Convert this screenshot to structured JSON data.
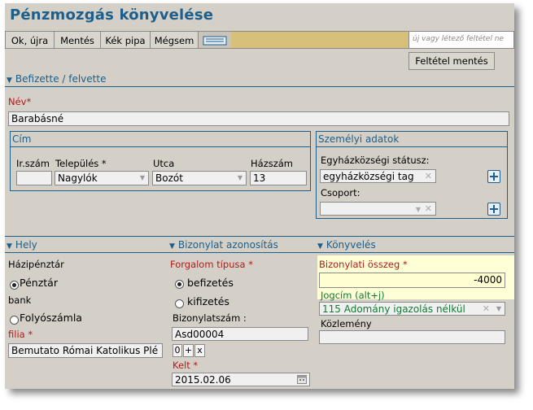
{
  "title": "Pénzmozgás könyvelése",
  "toolbar": {
    "ok_new": "Ok, újra",
    "save": "Mentés",
    "blue_tick": "Kék pipa",
    "cancel": "Mégsem",
    "filter_placeholder": "új vagy létező feltétel ne",
    "save_filter": "Feltétel mentés"
  },
  "payer_section": {
    "heading": "Befizette / felvette",
    "name_label": "Név*",
    "name_value": "Barabásné"
  },
  "address": {
    "title": "Cím",
    "zip_label": "Ir.szám",
    "zip_value": "",
    "city_label": "Település *",
    "city_value": "Nagylók",
    "street_label": "Utca",
    "street_value": "Bozót",
    "house_label": "Házszám",
    "house_value": "13"
  },
  "personal": {
    "title": "Személyi adatok",
    "status_label": "Egyházközségi státusz:",
    "status_value": "egyházközségi tag",
    "group_label": "Csoport:",
    "group_value": ""
  },
  "place": {
    "heading": "Hely",
    "cash_label": "Házipénztár",
    "cash_option": "Pénztár",
    "bank_label": "bank",
    "bank_option": "Folyószámla",
    "branch_label": "filia *",
    "branch_value": "Bemutato Római Katolikus Plé"
  },
  "document": {
    "heading": "Bizonylat azonosítás",
    "traffic_label": "Forgalom típusa *",
    "deposit": "befizetés",
    "payout": "kifizetés",
    "number_label": "Bizonylatszám :",
    "number_value": "Asd00004",
    "stepper_zero": "0",
    "stepper_plus": "+",
    "stepper_x": "x",
    "date_label": "Kelt *",
    "date_value": "2015.02.06"
  },
  "booking": {
    "heading": "Könyvelés",
    "amount_label": "Bizonylati összeg *",
    "amount_value": "-4000",
    "title_label": "Jogcím (alt+j)",
    "title_value": "115 Adomány igazolás nélkül",
    "comment_label": "Közlemény",
    "comment_value": ""
  },
  "colors": {
    "accent": "#1d5f8a",
    "required": "#b01a1a",
    "panel": "#d4d0c8",
    "highlight": "#ffffd6",
    "filter_strip": "#d6c07a"
  }
}
